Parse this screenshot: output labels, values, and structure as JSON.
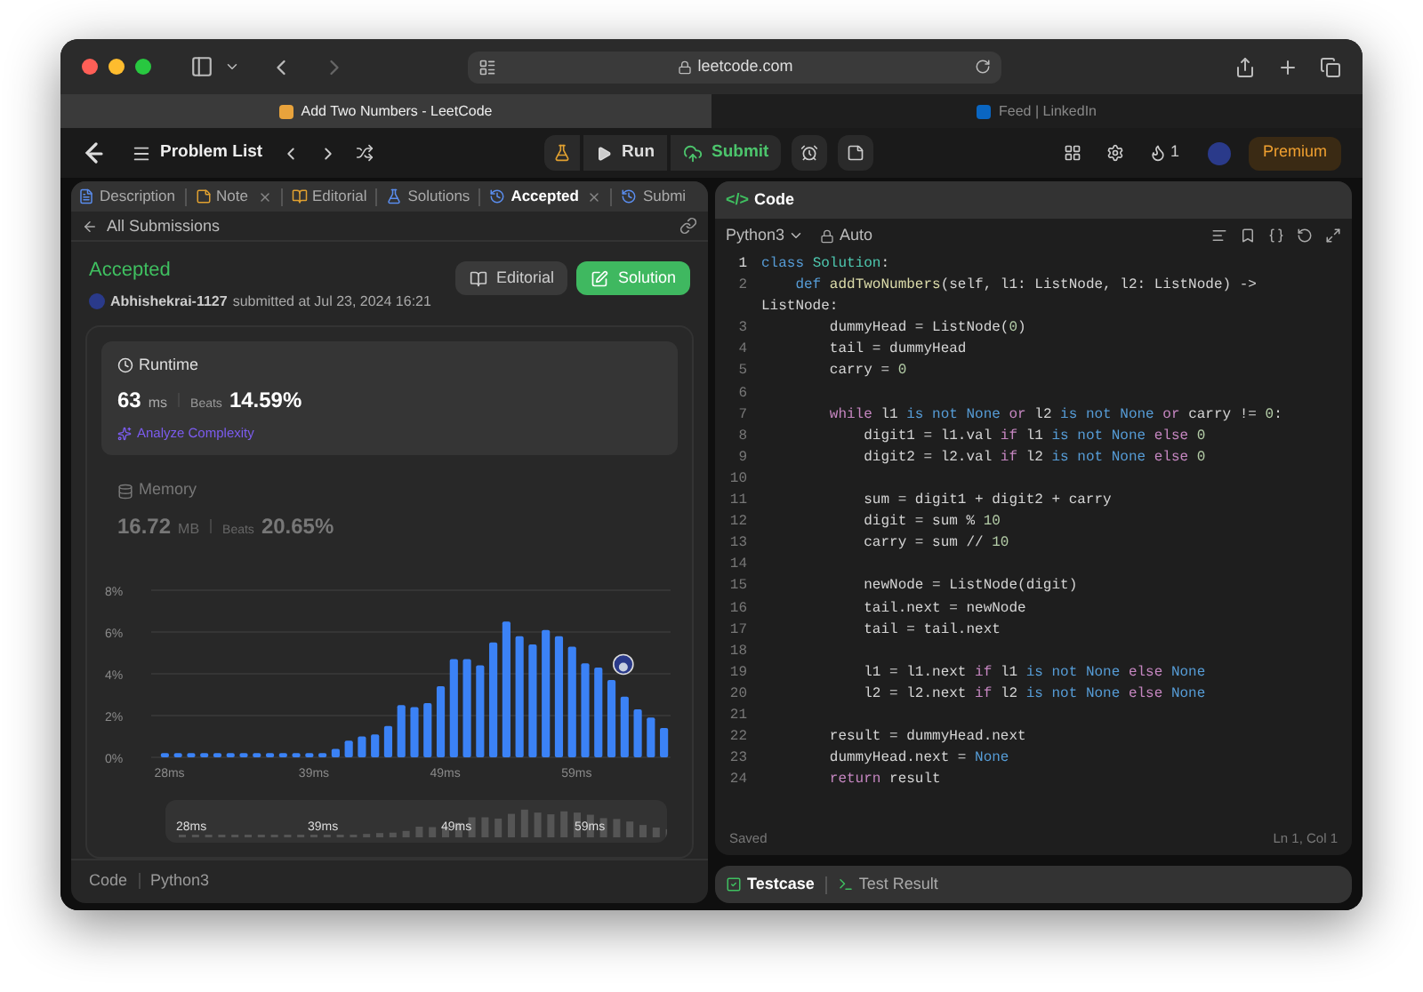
{
  "browser": {
    "url": "leetcode.com",
    "tabs": [
      {
        "title": "Add Two Numbers - LeetCode",
        "selected": true
      },
      {
        "title": "Feed | LinkedIn",
        "selected": false
      }
    ]
  },
  "nav": {
    "problem_list": "Problem List",
    "run": "Run",
    "submit": "Submit",
    "streak": "1",
    "premium": "Premium"
  },
  "left_tabs": [
    {
      "label": "Description",
      "kind": "description",
      "selected": false,
      "closable": false
    },
    {
      "label": "Note",
      "kind": "note",
      "selected": false,
      "closable": true
    },
    {
      "label": "Editorial",
      "kind": "editorial",
      "selected": false,
      "closable": false
    },
    {
      "label": "Solutions",
      "kind": "solutions",
      "selected": false,
      "closable": false
    },
    {
      "label": "Accepted",
      "kind": "accepted",
      "selected": true,
      "closable": true
    },
    {
      "label": "Submi",
      "kind": "submissions",
      "selected": false,
      "closable": false
    }
  ],
  "submission": {
    "back": "All Submissions",
    "status": "Accepted",
    "user": "Abhishekrai-1127",
    "submitted": "submitted at Jul 23, 2024 16:21",
    "editorial": "Editorial",
    "solution": "Solution"
  },
  "metrics": [
    {
      "kind": "runtime",
      "title": "Runtime",
      "value": "63",
      "unit": "ms",
      "beats_label": "Beats",
      "beats": "14.59%",
      "analyze": "Analyze Complexity",
      "selected": true
    },
    {
      "kind": "memory",
      "title": "Memory",
      "value": "16.72",
      "unit": "MB",
      "beats_label": "Beats",
      "beats": "20.65%",
      "selected": false
    }
  ],
  "chart_data": {
    "type": "bar",
    "x": [
      28,
      29,
      30,
      31,
      32,
      33,
      34,
      35,
      36,
      37,
      38,
      39,
      40,
      41,
      42,
      43,
      44,
      45,
      46,
      47,
      48,
      49,
      50,
      51,
      52,
      53,
      54,
      55,
      56,
      57,
      58,
      59,
      60,
      61,
      62,
      63,
      64,
      65,
      66
    ],
    "xlim": [
      27.5,
      66.5
    ],
    "grid": true,
    "series": [
      {
        "color": "#3b82f6",
        "values": [
          0.2,
          0.2,
          0.2,
          0.2,
          0.2,
          0.2,
          0.2,
          0.2,
          0.2,
          0.2,
          0.2,
          0.2,
          0.2,
          0.4,
          0.8,
          1.0,
          1.1,
          1.5,
          2.5,
          2.4,
          2.6,
          3.4,
          4.7,
          4.7,
          4.4,
          5.5,
          6.5,
          5.8,
          5.4,
          6.1,
          5.8,
          5.3,
          4.5,
          4.3,
          3.7,
          2.9,
          2.3,
          1.9,
          1.4
        ]
      }
    ],
    "ylim": [
      0,
      8
    ],
    "yticks": [
      {
        "value": 0,
        "label": "0%"
      },
      {
        "value": 2,
        "label": "2%"
      },
      {
        "value": 4,
        "label": "4%"
      },
      {
        "value": 6,
        "label": "6%"
      },
      {
        "value": 8,
        "label": "8%"
      }
    ],
    "xticks": [
      {
        "value": 28,
        "label": "28ms"
      },
      {
        "value": 39,
        "label": "39ms"
      },
      {
        "value": 49,
        "label": "49ms"
      },
      {
        "value": 59,
        "label": "59ms"
      }
    ]
  },
  "overview_labels": [
    "28ms",
    "39ms",
    "49ms",
    "59ms"
  ],
  "footer": {
    "code": "Code",
    "language": "Python3"
  },
  "editor": {
    "icon": "</>",
    "title": "Code",
    "language": "Python3",
    "mode": "Auto",
    "status": "Saved",
    "cursor": "Ln 1, Col 1",
    "lines": [
      {
        "n": "1",
        "segs": [
          {
            "text": "class",
            "kind": "op"
          },
          {
            "text": " Solution",
            "kind": "cls"
          },
          {
            "text": ":",
            "kind": "p"
          }
        ]
      },
      {
        "n": "2",
        "segs": [
          {
            "text": "    def",
            "kind": "op"
          },
          {
            "text": " addTwoNumbers",
            "kind": "fn"
          },
          {
            "text": "(self, l1: ListNode, l2: ListNode) ->",
            "kind": "p"
          }
        ],
        "wrap": [
          {
            "text": "ListNode:",
            "kind": "p"
          }
        ]
      },
      {
        "n": "3",
        "segs": [
          {
            "text": "        dummyHead = ListNode(",
            "kind": "p"
          },
          {
            "text": "0",
            "kind": "num"
          },
          {
            "text": ")",
            "kind": "p"
          }
        ]
      },
      {
        "n": "4",
        "segs": [
          {
            "text": "        tail = dummyHead",
            "kind": "p"
          }
        ]
      },
      {
        "n": "5",
        "segs": [
          {
            "text": "        carry = ",
            "kind": "p"
          },
          {
            "text": "0",
            "kind": "num"
          }
        ]
      },
      {
        "n": "6"
      },
      {
        "n": "7",
        "segs": [
          {
            "text": "        while",
            "kind": "kw"
          },
          {
            "text": " l1 ",
            "kind": "p"
          },
          {
            "text": "is not None ",
            "kind": "op"
          },
          {
            "text": "or",
            "kind": "kw"
          },
          {
            "text": " l2 ",
            "kind": "p"
          },
          {
            "text": "is not None ",
            "kind": "op"
          },
          {
            "text": "or",
            "kind": "kw"
          },
          {
            "text": " carry != ",
            "kind": "p"
          },
          {
            "text": "0",
            "kind": "num"
          },
          {
            "text": ":",
            "kind": "p"
          }
        ]
      },
      {
        "n": "8",
        "segs": [
          {
            "text": "            digit1 = l1.val ",
            "kind": "p"
          },
          {
            "text": "if",
            "kind": "kw"
          },
          {
            "text": " l1 ",
            "kind": "p"
          },
          {
            "text": "is not None ",
            "kind": "op"
          },
          {
            "text": "else",
            "kind": "kw"
          },
          {
            "text": " 0",
            "kind": "num"
          }
        ]
      },
      {
        "n": "9",
        "segs": [
          {
            "text": "            digit2 = l2.val ",
            "kind": "p"
          },
          {
            "text": "if",
            "kind": "kw"
          },
          {
            "text": " l2 ",
            "kind": "p"
          },
          {
            "text": "is not None ",
            "kind": "op"
          },
          {
            "text": "else",
            "kind": "kw"
          },
          {
            "text": " 0",
            "kind": "num"
          }
        ]
      },
      {
        "n": "10"
      },
      {
        "n": "11",
        "segs": [
          {
            "text": "            sum = digit1 + digit2 + carry",
            "kind": "p"
          }
        ]
      },
      {
        "n": "12",
        "segs": [
          {
            "text": "            digit = sum % ",
            "kind": "p"
          },
          {
            "text": "10",
            "kind": "num"
          }
        ]
      },
      {
        "n": "13",
        "segs": [
          {
            "text": "            carry = sum // ",
            "kind": "p"
          },
          {
            "text": "10",
            "kind": "num"
          }
        ]
      },
      {
        "n": "14"
      },
      {
        "n": "15",
        "segs": [
          {
            "text": "            newNode = ListNode(digit)",
            "kind": "p"
          }
        ]
      },
      {
        "n": "16",
        "segs": [
          {
            "text": "            tail.next = newNode",
            "kind": "p"
          }
        ]
      },
      {
        "n": "17",
        "segs": [
          {
            "text": "            tail = tail.next",
            "kind": "p"
          }
        ]
      },
      {
        "n": "18"
      },
      {
        "n": "19",
        "segs": [
          {
            "text": "            l1 = l1.next ",
            "kind": "p"
          },
          {
            "text": "if",
            "kind": "kw"
          },
          {
            "text": " l1 ",
            "kind": "p"
          },
          {
            "text": "is not None ",
            "kind": "op"
          },
          {
            "text": "else",
            "kind": "kw"
          },
          {
            "text": " None",
            "kind": "op"
          }
        ]
      },
      {
        "n": "20",
        "segs": [
          {
            "text": "            l2 = l2.next ",
            "kind": "p"
          },
          {
            "text": "if",
            "kind": "kw"
          },
          {
            "text": " l2 ",
            "kind": "p"
          },
          {
            "text": "is not None ",
            "kind": "op"
          },
          {
            "text": "else",
            "kind": "kw"
          },
          {
            "text": " None",
            "kind": "op"
          }
        ]
      },
      {
        "n": "21"
      },
      {
        "n": "22",
        "segs": [
          {
            "text": "        result = dummyHead.next",
            "kind": "p"
          }
        ]
      },
      {
        "n": "23",
        "segs": [
          {
            "text": "        dummyHead.next = ",
            "kind": "p"
          },
          {
            "text": "None",
            "kind": "op"
          }
        ]
      },
      {
        "n": "24",
        "segs": [
          {
            "text": "        return",
            "kind": "kw"
          },
          {
            "text": " result",
            "kind": "p"
          }
        ]
      }
    ]
  },
  "console_tabs": [
    {
      "label": "Testcase",
      "kind": "testcase",
      "selected": true
    },
    {
      "label": "Test Result",
      "kind": "result",
      "selected": false
    }
  ]
}
